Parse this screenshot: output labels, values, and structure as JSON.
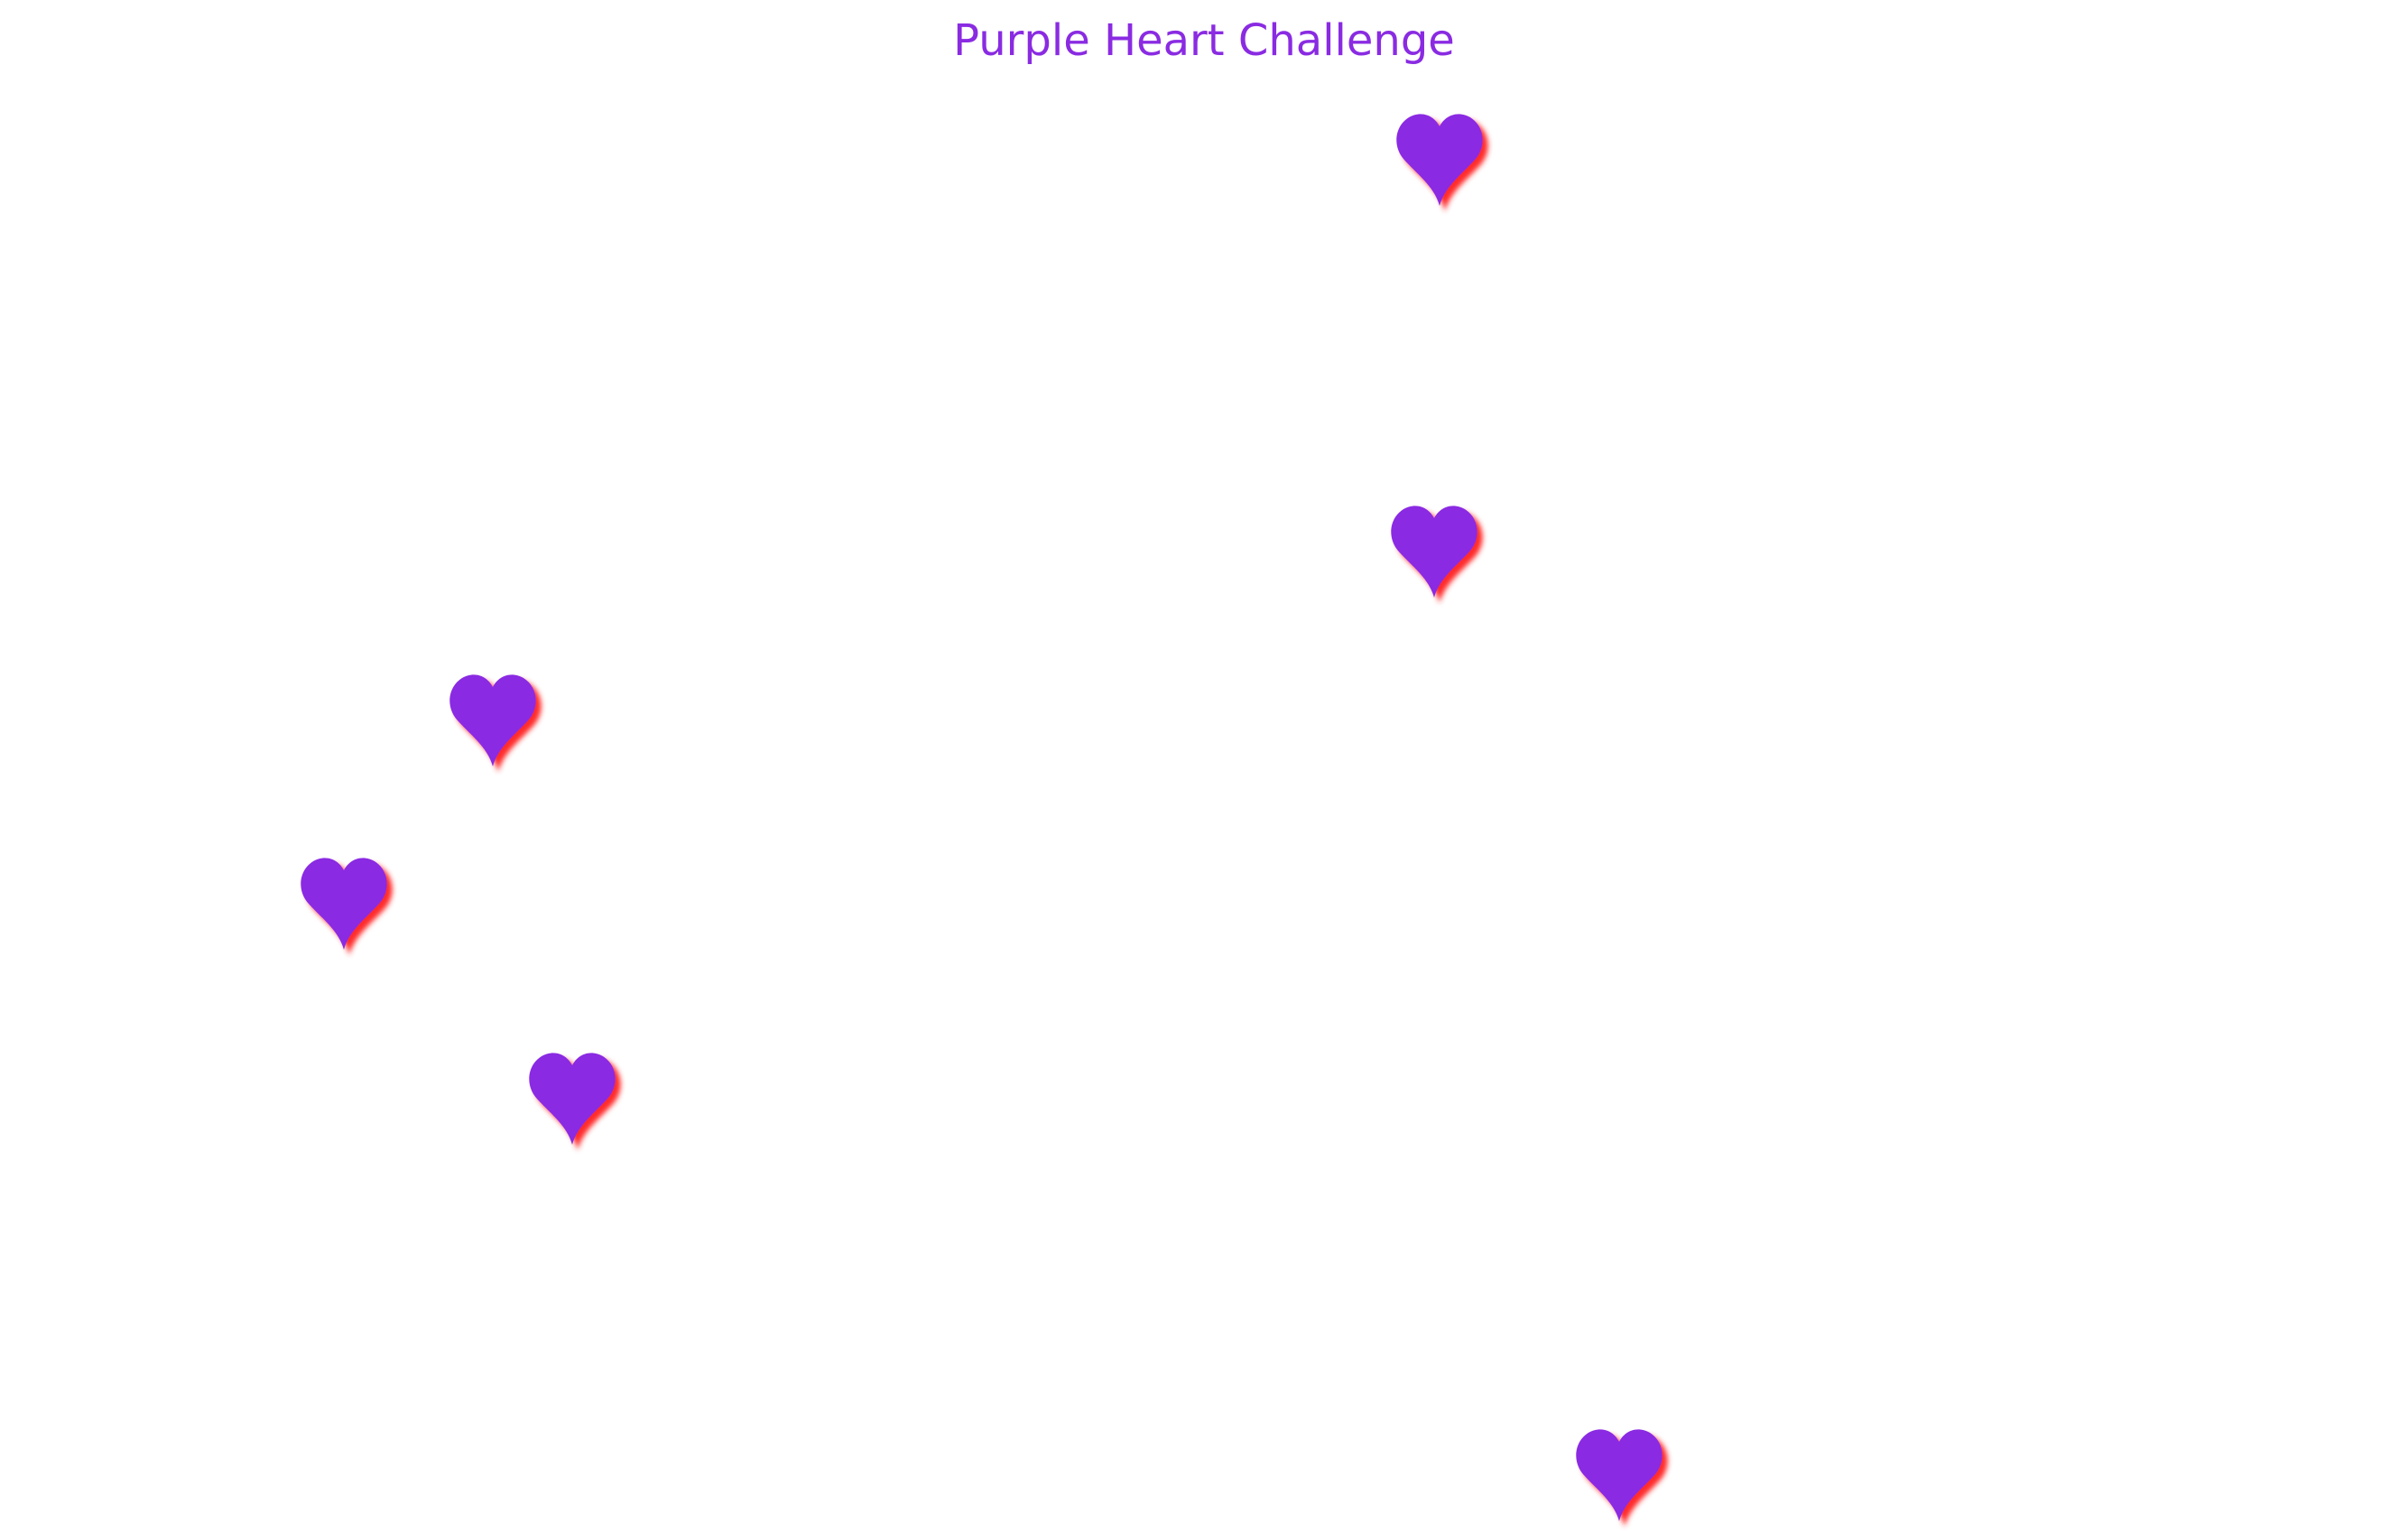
{
  "game": {
    "title": "Purple Heart Challenge"
  },
  "colors": {
    "heart": "#8a2be2",
    "heart_shadow": "#ff2a2a",
    "title": "#8a2be2",
    "background": "#ffffff"
  },
  "icons": {
    "heart": "heart-icon"
  },
  "hearts_count": 6
}
